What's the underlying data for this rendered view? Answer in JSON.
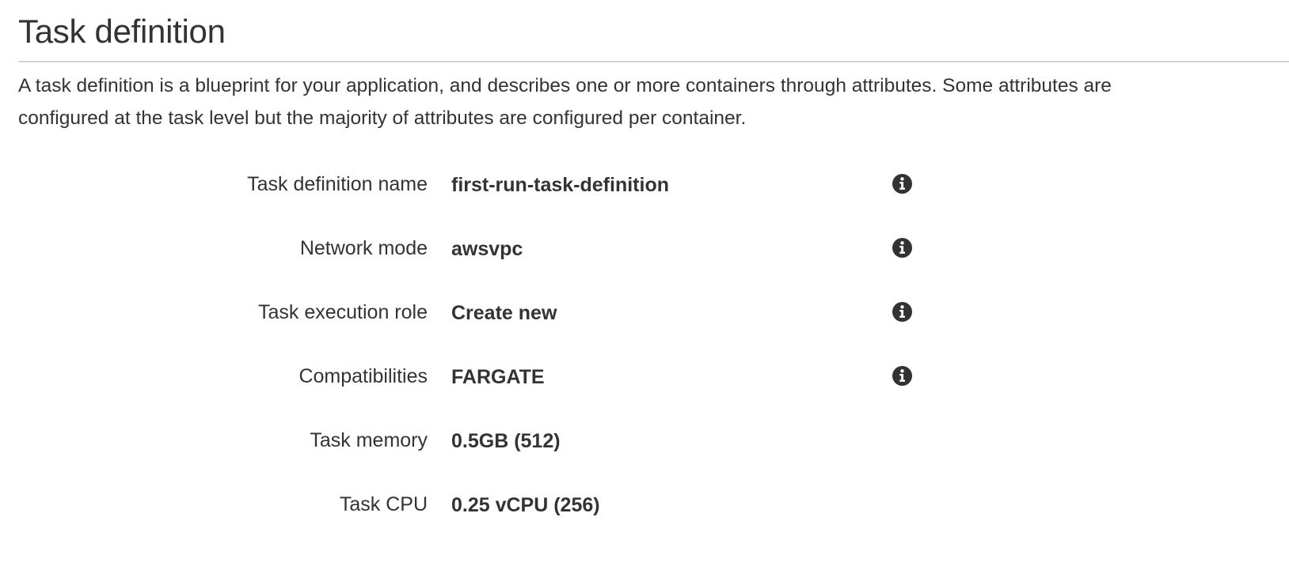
{
  "section": {
    "title": "Task definition",
    "description_line1": "A task definition is a blueprint for your application, and describes one or more containers through attributes. Some attributes are",
    "description_line2": "configured at the task level but the majority of attributes are configured per container."
  },
  "fields": [
    {
      "label": "Task definition name",
      "value": "first-run-task-definition",
      "info_icon": "info-circle-icon"
    },
    {
      "label": "Network mode",
      "value": "awsvpc",
      "info_icon": "info-circle-icon"
    },
    {
      "label": "Task execution role",
      "value": "Create new",
      "info_icon": "info-circle-icon"
    },
    {
      "label": "Compatibilities",
      "value": "FARGATE",
      "info_icon": "info-circle-icon"
    },
    {
      "label": "Task memory",
      "value": "0.5GB (512)"
    },
    {
      "label": "Task CPU",
      "value": "0.25 vCPU (256)"
    }
  ],
  "colors": {
    "text": "#333333",
    "rule": "#d5d5d5",
    "icon": "#333333"
  }
}
